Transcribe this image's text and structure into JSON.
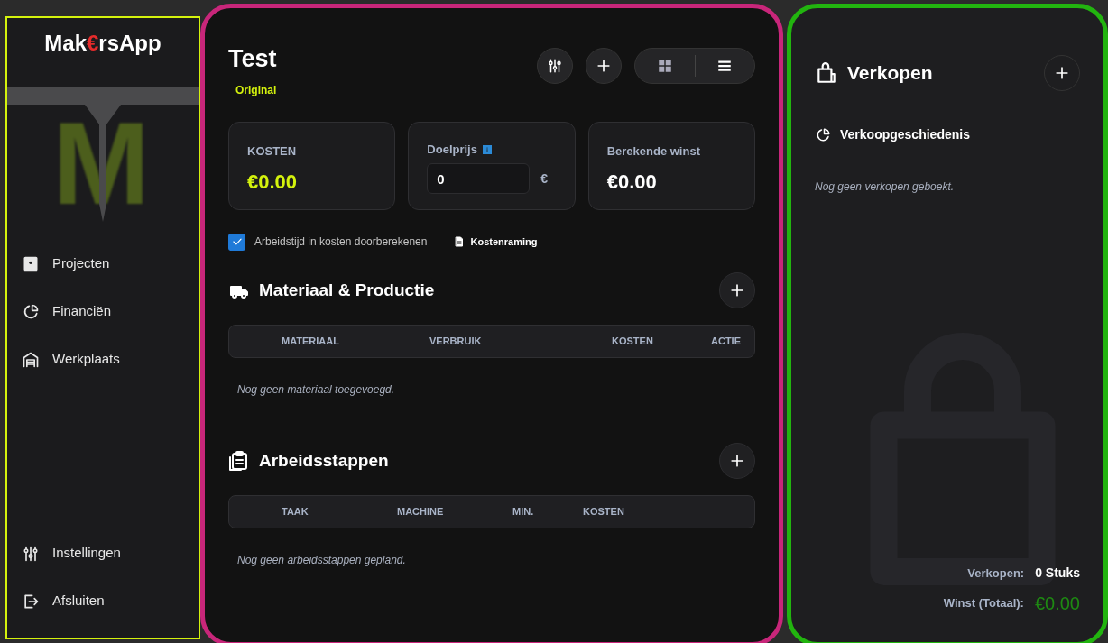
{
  "sidebar": {
    "logo": [
      {
        "text": "Mak",
        "accent": false
      },
      {
        "text": "€",
        "accent": true
      },
      {
        "text": "rsApp",
        "accent": false
      }
    ],
    "hero_letter": "M",
    "nav": [
      {
        "kind": "book",
        "label": "Projecten"
      },
      {
        "kind": "pie",
        "label": "Financiën"
      },
      {
        "kind": "garage",
        "label": "Werkplaats"
      }
    ],
    "bottom_nav": [
      {
        "kind": "sliders",
        "label": "Instellingen"
      },
      {
        "kind": "exit",
        "label": "Afsluiten"
      }
    ]
  },
  "project": {
    "title": "Test",
    "badge": "Original",
    "stats": [
      {
        "kind": "value",
        "label": "KOSTEN",
        "value": "€0.00",
        "accent": true
      },
      {
        "kind": "input",
        "label": "Doelprijs",
        "value": "0",
        "unit": "€"
      },
      {
        "kind": "value",
        "label": "Berekende winst",
        "value": "€0.00",
        "accent": false
      }
    ],
    "labor_checkbox": {
      "label": "Arbeidstijd in kosten doorberekenen",
      "checked": true
    },
    "estimate_link": "Kostenraming",
    "sections": [
      {
        "kind": "truck",
        "title": "Materiaal & Productie",
        "columns": [
          "MATERIAAL",
          "VERBRUIK",
          "KOSTEN",
          "ACTIE"
        ],
        "empty": "Nog geen materiaal toegevoegd."
      },
      {
        "kind": "clipboard",
        "title": "Arbeidsstappen",
        "columns": [
          "TAAK",
          "MACHINE",
          "MIN.",
          "KOSTEN"
        ],
        "empty": "Nog geen arbeidsstappen gepland."
      }
    ]
  },
  "sales": {
    "title": "Verkopen",
    "history_title": "Verkoopgeschiedenis",
    "empty": "Nog geen verkopen geboekt.",
    "summary": [
      {
        "label": "Verkopen:",
        "value": "0 Stuks",
        "accent": false
      },
      {
        "label": "Winst (Totaal):",
        "value": "€0.00",
        "accent": true
      }
    ]
  }
}
